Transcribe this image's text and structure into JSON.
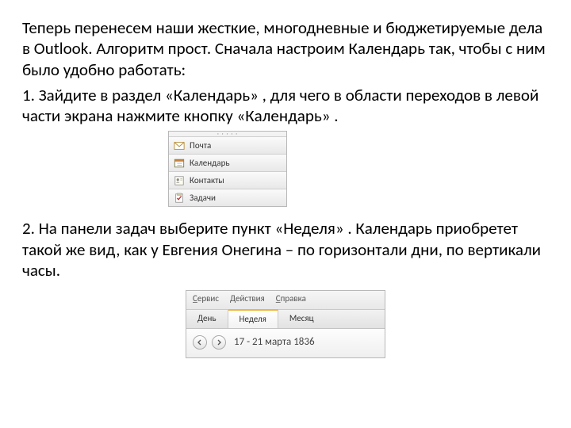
{
  "paragraph1": "Теперь перенесем наши жесткие, многодневные и бюджетируемые дела в Outlook. Алгоритм прост. Сначала настроим Календарь так, чтобы с ним было удобно работать:",
  "step1": "1. Зайдите в раздел «Календарь» , для чего в области переходов в левой части экрана нажмите кнопку «Календарь» .",
  "nav": {
    "items": [
      {
        "label": "Почта"
      },
      {
        "label": "Календарь"
      },
      {
        "label": "Контакты"
      },
      {
        "label": "Задачи"
      }
    ]
  },
  "step2": "2. На панели задач выберите пункт «Неделя» . Календарь приобретет такой же вид, как у Евгения Онегина – по горизонтали дни, по вертикали часы.",
  "toolbar": {
    "menu": {
      "service": "Сервис",
      "actions": "Действия",
      "help": "Справка"
    },
    "tabs": {
      "day": "День",
      "week": "Неделя",
      "month": "Месяц"
    },
    "date": "17 - 21 марта 1836"
  }
}
